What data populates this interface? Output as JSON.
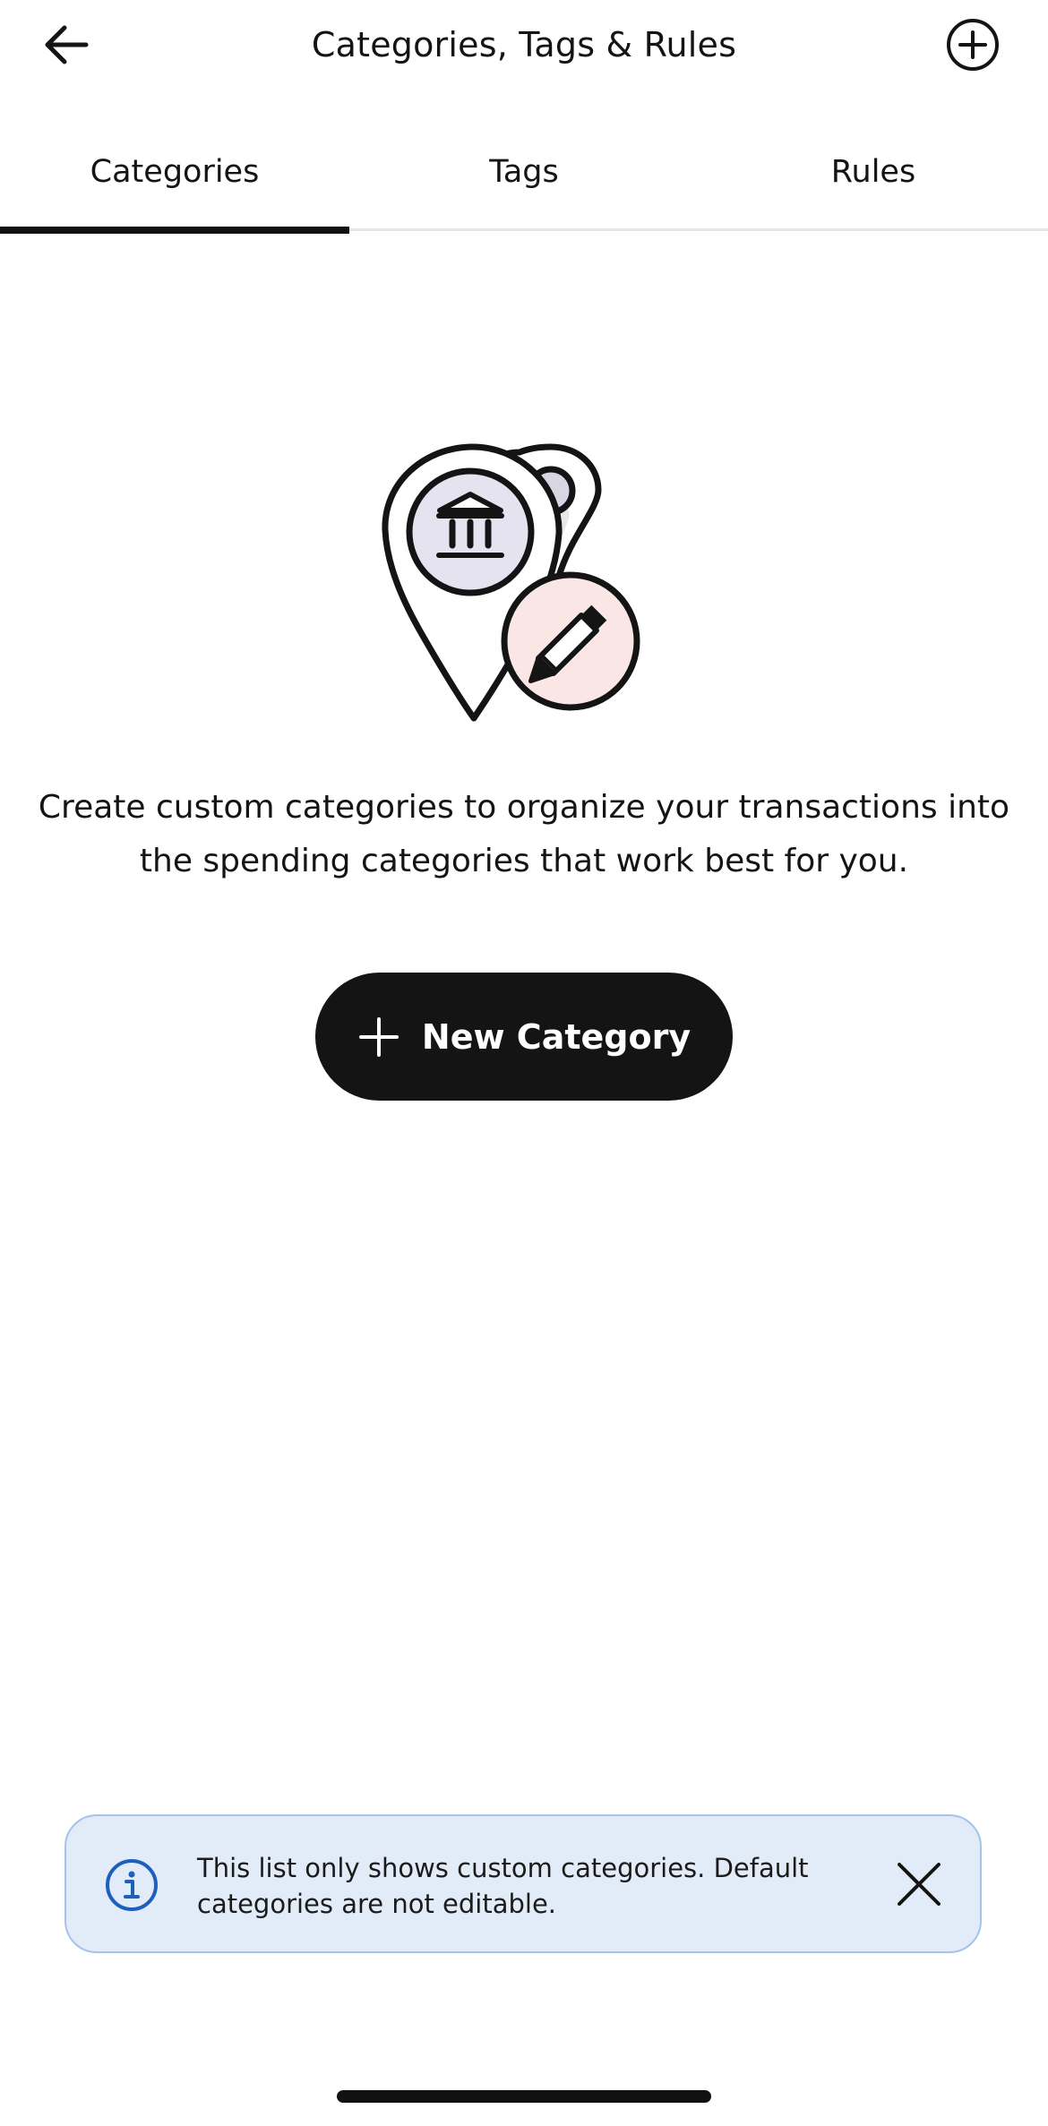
{
  "header": {
    "title": "Categories, Tags & Rules",
    "back_icon": "arrow-left-icon",
    "add_icon": "plus-circle-icon"
  },
  "tabs": [
    {
      "label": "Categories",
      "active": true
    },
    {
      "label": "Tags",
      "active": false
    },
    {
      "label": "Rules",
      "active": false
    }
  ],
  "empty_state": {
    "illustration_icons": [
      "map-pin-icon",
      "bank-icon",
      "pencil-icon"
    ],
    "description": "Create custom categories to organize your transactions into the spending categories that work best for you.",
    "button_label": "New Category",
    "button_icon": "plus-icon"
  },
  "banner": {
    "icon": "info-icon",
    "message": "This list only shows custom categories. Default categories are not editable.",
    "close_icon": "close-icon"
  },
  "colors": {
    "primary": "#141414",
    "banner_bg": "#e2ecf8",
    "banner_border": "#a6c3e8",
    "info_blue": "#1d5fbd",
    "pin_lavender": "#e6e3f1",
    "pencil_pink": "#fbe6e6"
  }
}
